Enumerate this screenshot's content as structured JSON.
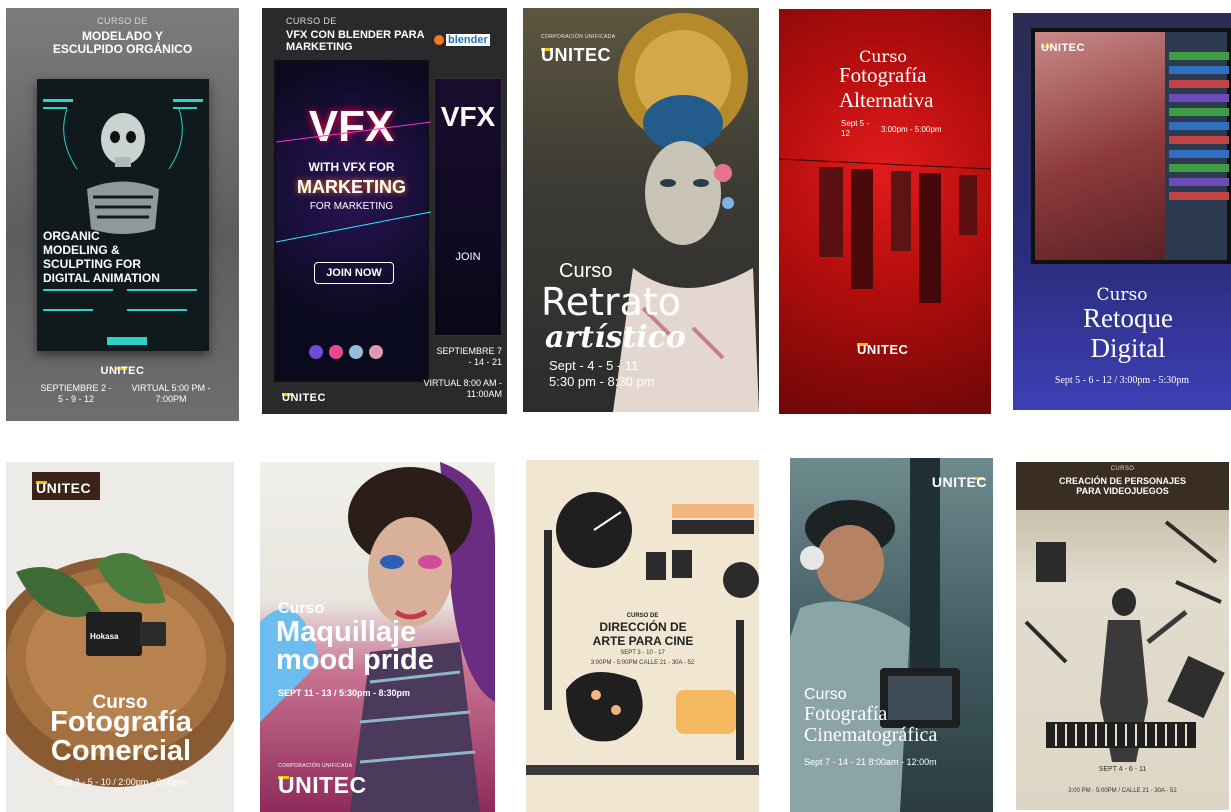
{
  "posters": [
    {
      "kicker": "CURSO DE",
      "title": "MODELADO Y ESCULPIDO ORGÁNICO",
      "inner_title": "ORGANIC MODELING & SCULPTING FOR DIGITAL ANIMATION",
      "logo": "UNITEC",
      "dates": "SEPTIEMBRE 2 - 5 - 9 - 12",
      "schedule": "VIRTUAL 5:00 PM - 7:00PM"
    },
    {
      "kicker": "CURSO DE",
      "title": "VFX CON BLENDER PARA MARKETING",
      "brand": "blender",
      "big": "VFX",
      "line1": "WITH VFX FOR",
      "line2": "MARKETING",
      "line3": "FOR MARKETING",
      "cta": "JOIN NOW",
      "side_big": "VFX",
      "side_cta": "JOIN",
      "logo": "UNITEC",
      "dates": "SEPTIEMBRE 7 - 14 - 21",
      "schedule": "VIRTUAL 8:00 AM - 11:00AM"
    },
    {
      "corp": "CORPORACIÓN UNIFICADA",
      "logo": "UNITEC",
      "kicker": "Curso",
      "title": "Retrato",
      "subtitle": "artístico",
      "dates": "Sept - 4 - 5 - 11",
      "schedule": "5:30 pm - 8:30 pm"
    },
    {
      "kicker": "Curso",
      "title": "Fotografía Alternativa",
      "dates": "Sept 5 - 12",
      "schedule": "3:00pm - 5:00pm",
      "logo": "UNITEC"
    },
    {
      "logo": "UNITEC",
      "kicker": "Curso",
      "title": "Retoque Digital",
      "dates": "Sept 5 - 6 - 12 / 3:00pm - 5:30pm"
    },
    {
      "logo": "UNITEC",
      "product": "Hokasa",
      "kicker": "Curso",
      "title": "Fotografía Comercial",
      "dates": "Sept 3 - 5 - 10 / 2:00pm - 6:00pm"
    },
    {
      "kicker": "Curso",
      "title": "Maquillaje mood pride",
      "dates": "SEPT 11 - 13 / 5:30pm - 8:30pm",
      "corp": "CORPORACIÓN UNIFICADA",
      "logo": "UNITEC"
    },
    {
      "kicker": "CURSO DE",
      "title": "DIRECCIÓN DE ARTE PARA CINE",
      "dates": "SEPT 3 - 10 - 17",
      "schedule": "3:00PM - 5:00PM CALLE 21 - 30A - 52"
    },
    {
      "logo": "UNITEC",
      "kicker": "Curso",
      "title": "Fotografía Cinematográfica",
      "dates": "Sept 7 - 14 - 21 8:00am - 12:00m"
    },
    {
      "kicker": "CURSO",
      "title": "CREACIÓN DE PERSONAJES PARA VIDEOJUEGOS",
      "dates": "SEPT 4 - 6 - 11",
      "schedule": "3:00 PM - 5:00PM / CALLE 21 - 30A - 52"
    }
  ]
}
